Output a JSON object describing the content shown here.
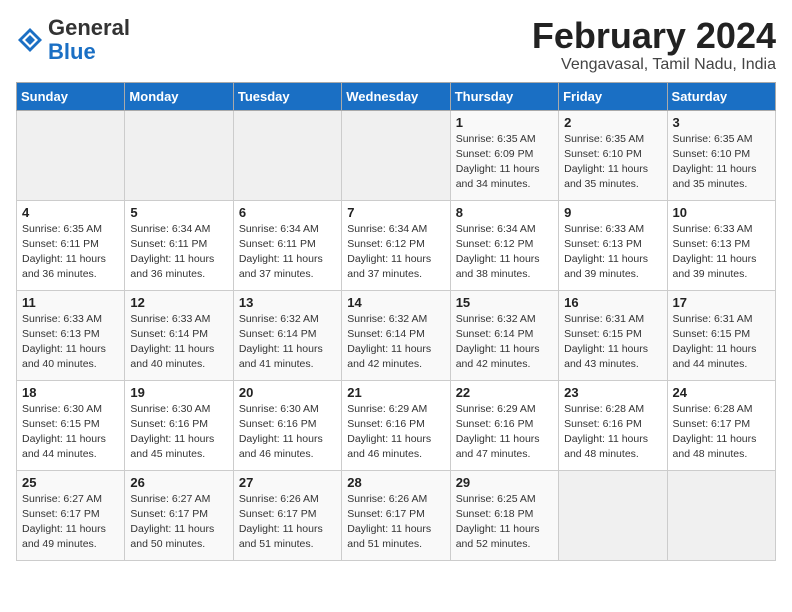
{
  "header": {
    "logo_general": "General",
    "logo_blue": "Blue",
    "month_title": "February 2024",
    "location": "Vengavasal, Tamil Nadu, India"
  },
  "weekdays": [
    "Sunday",
    "Monday",
    "Tuesday",
    "Wednesday",
    "Thursday",
    "Friday",
    "Saturday"
  ],
  "weeks": [
    [
      {
        "day": "",
        "info": ""
      },
      {
        "day": "",
        "info": ""
      },
      {
        "day": "",
        "info": ""
      },
      {
        "day": "",
        "info": ""
      },
      {
        "day": "1",
        "info": "Sunrise: 6:35 AM\nSunset: 6:09 PM\nDaylight: 11 hours\nand 34 minutes."
      },
      {
        "day": "2",
        "info": "Sunrise: 6:35 AM\nSunset: 6:10 PM\nDaylight: 11 hours\nand 35 minutes."
      },
      {
        "day": "3",
        "info": "Sunrise: 6:35 AM\nSunset: 6:10 PM\nDaylight: 11 hours\nand 35 minutes."
      }
    ],
    [
      {
        "day": "4",
        "info": "Sunrise: 6:35 AM\nSunset: 6:11 PM\nDaylight: 11 hours\nand 36 minutes."
      },
      {
        "day": "5",
        "info": "Sunrise: 6:34 AM\nSunset: 6:11 PM\nDaylight: 11 hours\nand 36 minutes."
      },
      {
        "day": "6",
        "info": "Sunrise: 6:34 AM\nSunset: 6:11 PM\nDaylight: 11 hours\nand 37 minutes."
      },
      {
        "day": "7",
        "info": "Sunrise: 6:34 AM\nSunset: 6:12 PM\nDaylight: 11 hours\nand 37 minutes."
      },
      {
        "day": "8",
        "info": "Sunrise: 6:34 AM\nSunset: 6:12 PM\nDaylight: 11 hours\nand 38 minutes."
      },
      {
        "day": "9",
        "info": "Sunrise: 6:33 AM\nSunset: 6:13 PM\nDaylight: 11 hours\nand 39 minutes."
      },
      {
        "day": "10",
        "info": "Sunrise: 6:33 AM\nSunset: 6:13 PM\nDaylight: 11 hours\nand 39 minutes."
      }
    ],
    [
      {
        "day": "11",
        "info": "Sunrise: 6:33 AM\nSunset: 6:13 PM\nDaylight: 11 hours\nand 40 minutes."
      },
      {
        "day": "12",
        "info": "Sunrise: 6:33 AM\nSunset: 6:14 PM\nDaylight: 11 hours\nand 40 minutes."
      },
      {
        "day": "13",
        "info": "Sunrise: 6:32 AM\nSunset: 6:14 PM\nDaylight: 11 hours\nand 41 minutes."
      },
      {
        "day": "14",
        "info": "Sunrise: 6:32 AM\nSunset: 6:14 PM\nDaylight: 11 hours\nand 42 minutes."
      },
      {
        "day": "15",
        "info": "Sunrise: 6:32 AM\nSunset: 6:14 PM\nDaylight: 11 hours\nand 42 minutes."
      },
      {
        "day": "16",
        "info": "Sunrise: 6:31 AM\nSunset: 6:15 PM\nDaylight: 11 hours\nand 43 minutes."
      },
      {
        "day": "17",
        "info": "Sunrise: 6:31 AM\nSunset: 6:15 PM\nDaylight: 11 hours\nand 44 minutes."
      }
    ],
    [
      {
        "day": "18",
        "info": "Sunrise: 6:30 AM\nSunset: 6:15 PM\nDaylight: 11 hours\nand 44 minutes."
      },
      {
        "day": "19",
        "info": "Sunrise: 6:30 AM\nSunset: 6:16 PM\nDaylight: 11 hours\nand 45 minutes."
      },
      {
        "day": "20",
        "info": "Sunrise: 6:30 AM\nSunset: 6:16 PM\nDaylight: 11 hours\nand 46 minutes."
      },
      {
        "day": "21",
        "info": "Sunrise: 6:29 AM\nSunset: 6:16 PM\nDaylight: 11 hours\nand 46 minutes."
      },
      {
        "day": "22",
        "info": "Sunrise: 6:29 AM\nSunset: 6:16 PM\nDaylight: 11 hours\nand 47 minutes."
      },
      {
        "day": "23",
        "info": "Sunrise: 6:28 AM\nSunset: 6:16 PM\nDaylight: 11 hours\nand 48 minutes."
      },
      {
        "day": "24",
        "info": "Sunrise: 6:28 AM\nSunset: 6:17 PM\nDaylight: 11 hours\nand 48 minutes."
      }
    ],
    [
      {
        "day": "25",
        "info": "Sunrise: 6:27 AM\nSunset: 6:17 PM\nDaylight: 11 hours\nand 49 minutes."
      },
      {
        "day": "26",
        "info": "Sunrise: 6:27 AM\nSunset: 6:17 PM\nDaylight: 11 hours\nand 50 minutes."
      },
      {
        "day": "27",
        "info": "Sunrise: 6:26 AM\nSunset: 6:17 PM\nDaylight: 11 hours\nand 51 minutes."
      },
      {
        "day": "28",
        "info": "Sunrise: 6:26 AM\nSunset: 6:17 PM\nDaylight: 11 hours\nand 51 minutes."
      },
      {
        "day": "29",
        "info": "Sunrise: 6:25 AM\nSunset: 6:18 PM\nDaylight: 11 hours\nand 52 minutes."
      },
      {
        "day": "",
        "info": ""
      },
      {
        "day": "",
        "info": ""
      }
    ]
  ]
}
